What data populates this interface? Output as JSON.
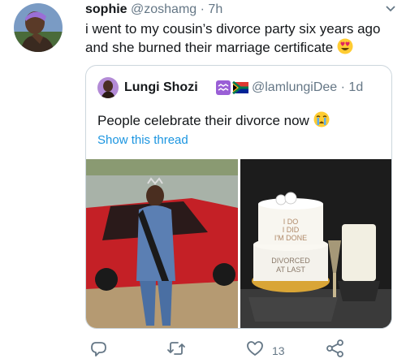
{
  "tweet": {
    "display_name": "sophie",
    "handle": "@zoshamg",
    "time": "· 7h",
    "text": "i went to my cousin’s divorce party six years ago and she burned their marriage certificate",
    "emoji": "heart-eyes-emoji"
  },
  "quoted_tweet": {
    "display_name": "Lungi Shozi",
    "badges": [
      "aquarius-icon",
      "south-africa-flag-icon"
    ],
    "handle": "@lamlungiDee",
    "time": "· 1d",
    "text": "People celebrate their divorce now",
    "emoji": "crying-face-emoji",
    "show_thread": "Show this thread",
    "images": {
      "left": "woman-with-tiara-and-red-car-photo",
      "right": "divorce-cake-photo"
    },
    "cake_text_top": [
      "I DO",
      "I DID",
      "I'M DONE"
    ],
    "cake_text_bottom": [
      "DIVORCED",
      "AT LAST"
    ]
  },
  "actions": {
    "reply_icon": "reply-icon",
    "retweet_icon": "retweet-icon",
    "like_icon": "heart-icon",
    "like_count": "13",
    "share_icon": "share-icon"
  },
  "colors": {
    "text": "#14171a",
    "secondary": "#657786",
    "link": "#1b95e0",
    "border": "#ccd6dd"
  }
}
